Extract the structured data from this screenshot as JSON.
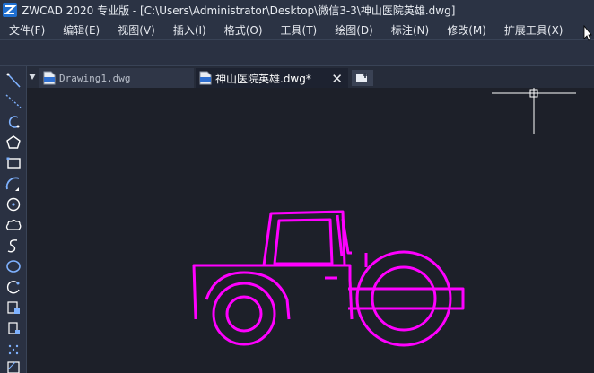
{
  "window": {
    "title": "ZWCAD 2020 专业版 - [C:\\Users\\Administrator\\Desktop\\微信3-3\\神山医院英雄.dwg]"
  },
  "menu": [
    {
      "label": "文件(F)"
    },
    {
      "label": "编辑(E)"
    },
    {
      "label": "视图(V)"
    },
    {
      "label": "插入(I)"
    },
    {
      "label": "格式(O)"
    },
    {
      "label": "工具(T)"
    },
    {
      "label": "绘图(D)"
    },
    {
      "label": "标注(N)"
    },
    {
      "label": "修改(M)"
    },
    {
      "label": "扩展工具(X)"
    }
  ],
  "tabs": [
    {
      "label": "Drawing1.dwg",
      "active": false
    },
    {
      "label": "神山医院英雄.dwg*",
      "active": true
    }
  ],
  "tab_close_glyph": "✕",
  "tools": [
    "line-icon",
    "construction-line-icon",
    "polyline-icon",
    "polygon-icon",
    "rectangle-icon",
    "arc-icon",
    "circle-icon",
    "revision-cloud-icon",
    "spline-icon",
    "ellipse-icon",
    "ellipse-arc-icon",
    "insert-block-icon",
    "make-block-icon",
    "point-icon",
    "hatch-icon"
  ],
  "colors": {
    "accent": "#1f6fd0",
    "drawing": "#ff00ff",
    "canvas": "#1d2029"
  }
}
